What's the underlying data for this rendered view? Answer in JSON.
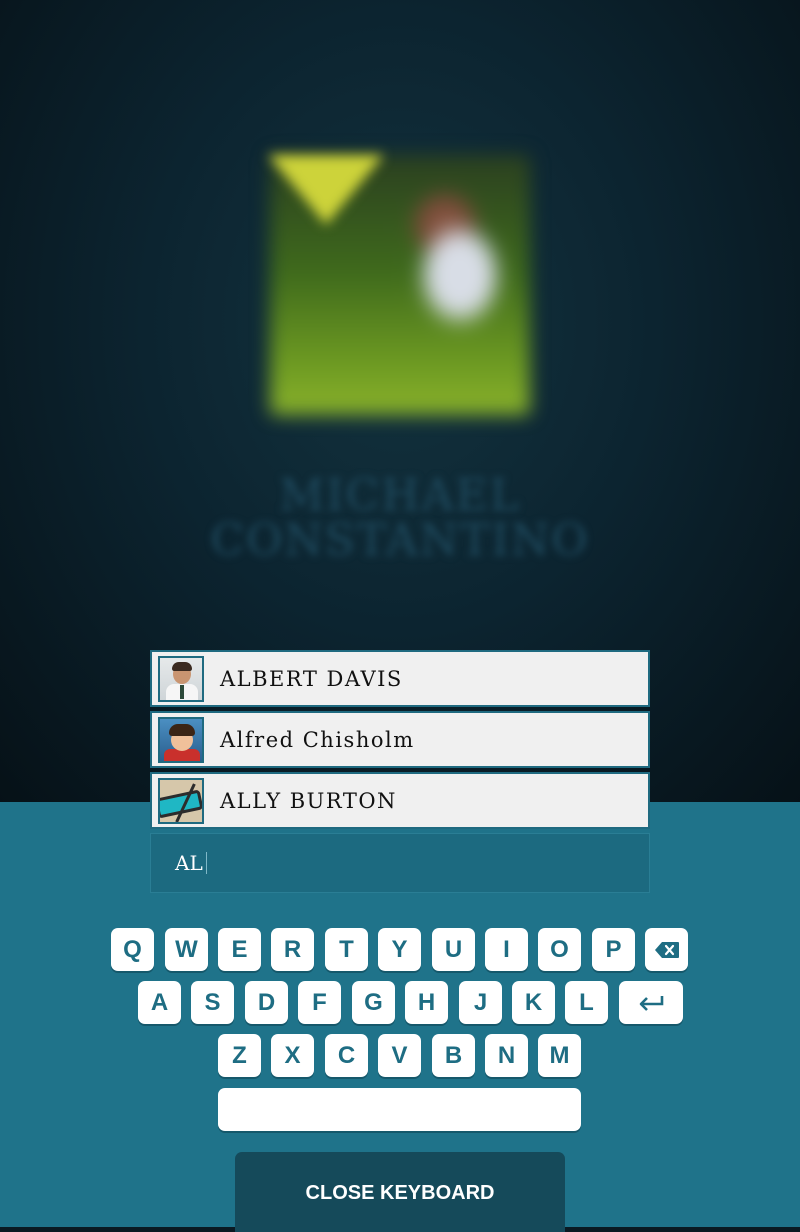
{
  "background_profile": {
    "name_line1": "MICHAEL",
    "name_line2": "CONSTANTINO"
  },
  "suggestions": [
    {
      "name": "ALBERT DAVIS"
    },
    {
      "name": "Alfred Chisholm"
    },
    {
      "name": "ALLY BURTON"
    }
  ],
  "search": {
    "value": "AL"
  },
  "keyboard": {
    "row1": [
      "Q",
      "W",
      "E",
      "R",
      "T",
      "Y",
      "U",
      "I",
      "O",
      "P"
    ],
    "row2": [
      "A",
      "S",
      "D",
      "F",
      "G",
      "H",
      "J",
      "K",
      "L"
    ],
    "row3": [
      "Z",
      "X",
      "C",
      "V",
      "B",
      "N",
      "M"
    ],
    "backspace_icon": "backspace-icon",
    "enter_icon": "enter-icon"
  },
  "close_keyboard_label": "CLOSE KEYBOARD",
  "colors": {
    "panel": "#1f738a",
    "key_text": "#1e6d83",
    "close_button": "#154a5a"
  }
}
